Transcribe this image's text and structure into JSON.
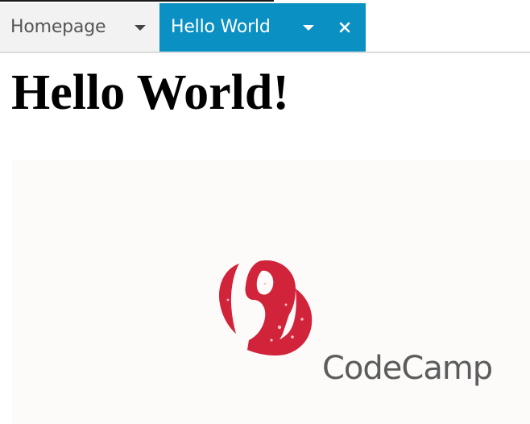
{
  "tabs": [
    {
      "label": "Homepage",
      "active": false
    },
    {
      "label": "Hello World",
      "active": true
    }
  ],
  "page": {
    "heading": "Hello World!"
  },
  "logo": {
    "wordmark": "CodeCamp",
    "mark_color": "#d1233a",
    "wordmark_color": "#5c5c5c"
  },
  "colors": {
    "active_tab": "#0a90c3",
    "inactive_tab": "#f2f2f2"
  },
  "icons": {
    "tab_menu": "chevron-down-icon",
    "tab_close": "close-icon"
  }
}
